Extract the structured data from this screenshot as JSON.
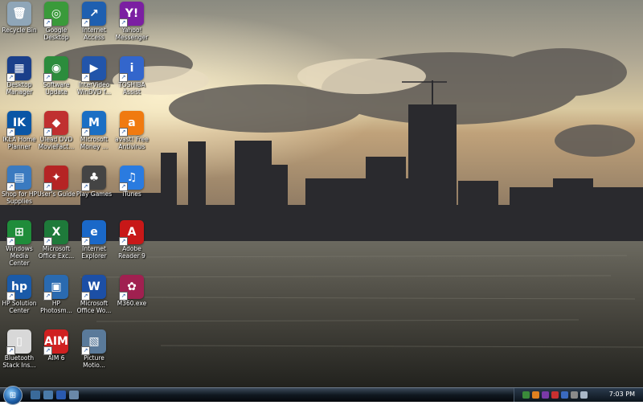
{
  "desktop_icons": [
    {
      "name": "recycle-bin",
      "label": "Recycle Bin",
      "glyph": "🗑",
      "color": "#8fa6b8"
    },
    {
      "name": "google-desktop",
      "label": "Google\nDesktop",
      "glyph": "◎",
      "color": "#3a9a3a"
    },
    {
      "name": "internet-access",
      "label": "Internet\nAccess",
      "glyph": "↗",
      "color": "#1e5fb0"
    },
    {
      "name": "yahoo-messenger",
      "label": "Yahoo!\nMessenger",
      "glyph": "Y!",
      "color": "#7b1fa2"
    },
    {
      "name": "desktop-manager",
      "label": "Desktop\nManager",
      "glyph": "▦",
      "color": "#1a3f8a"
    },
    {
      "name": "software-update",
      "label": "Software\nUpdate",
      "glyph": "◉",
      "color": "#2c8c3c"
    },
    {
      "name": "intervideo-windvd",
      "label": "InterVideo\nWinDVD f...",
      "glyph": "▶",
      "color": "#2255aa"
    },
    {
      "name": "toshiba-assist",
      "label": "TOSHIBA\nAssist",
      "glyph": "i",
      "color": "#3366cc"
    },
    {
      "name": "ikea-home-planner",
      "label": "IKEA Home\nPlanner",
      "glyph": "IK",
      "color": "#0a56a6"
    },
    {
      "name": "ulead-dvd",
      "label": "Ulead DVD\nMovieFact...",
      "glyph": "◆",
      "color": "#c03030"
    },
    {
      "name": "microsoft-money",
      "label": "Microsoft\nMoney ...",
      "glyph": "M",
      "color": "#1b6fc4"
    },
    {
      "name": "avast-antivirus",
      "label": "avast! Free\nAntivirus",
      "glyph": "a",
      "color": "#f07a10"
    },
    {
      "name": "shop-for-hp-supplies",
      "label": "Shop for HP\nSupplies",
      "glyph": "▤",
      "color": "#3a7ac0"
    },
    {
      "name": "users-guide",
      "label": "User's Guide",
      "glyph": "✦",
      "color": "#b52424"
    },
    {
      "name": "play-games",
      "label": "Play Games",
      "glyph": "♣",
      "color": "#444444"
    },
    {
      "name": "itunes",
      "label": "iTunes",
      "glyph": "♫",
      "color": "#2a7be0"
    },
    {
      "name": "windows-media-center",
      "label": "Windows\nMedia Center",
      "glyph": "⊞",
      "color": "#1f8c3a"
    },
    {
      "name": "microsoft-office-excel",
      "label": "Microsoft\nOffice Exc...",
      "glyph": "X",
      "color": "#1e7a3a"
    },
    {
      "name": "internet-explorer",
      "label": "Internet\nExplorer",
      "glyph": "e",
      "color": "#1a68c8"
    },
    {
      "name": "adobe-reader",
      "label": "Adobe\nReader 9",
      "glyph": "A",
      "color": "#c81818"
    },
    {
      "name": "hp-solution-center",
      "label": "HP Solution\nCenter",
      "glyph": "hp",
      "color": "#1a5aa8"
    },
    {
      "name": "hp-photosmart",
      "label": "HP\nPhotosm...",
      "glyph": "▣",
      "color": "#2a6ab0"
    },
    {
      "name": "microsoft-office-word",
      "label": "Microsoft\nOffice Wo...",
      "glyph": "W",
      "color": "#1c4fa6"
    },
    {
      "name": "m360-exe",
      "label": "M360.exe",
      "glyph": "✿",
      "color": "#a02050"
    },
    {
      "name": "bluetooth-stack",
      "label": "Bluetooth\nStack Ins...",
      "glyph": "▯",
      "color": "#d8d8d8"
    },
    {
      "name": "aim",
      "label": "AIM 6",
      "glyph": "AIM",
      "color": "#d02020"
    },
    {
      "name": "picture-motion",
      "label": "Picture\nMotio...",
      "glyph": "▧",
      "color": "#5a7a9a"
    }
  ],
  "taskbar": {
    "start_label": "⊞",
    "clock": "7:03 PM"
  }
}
